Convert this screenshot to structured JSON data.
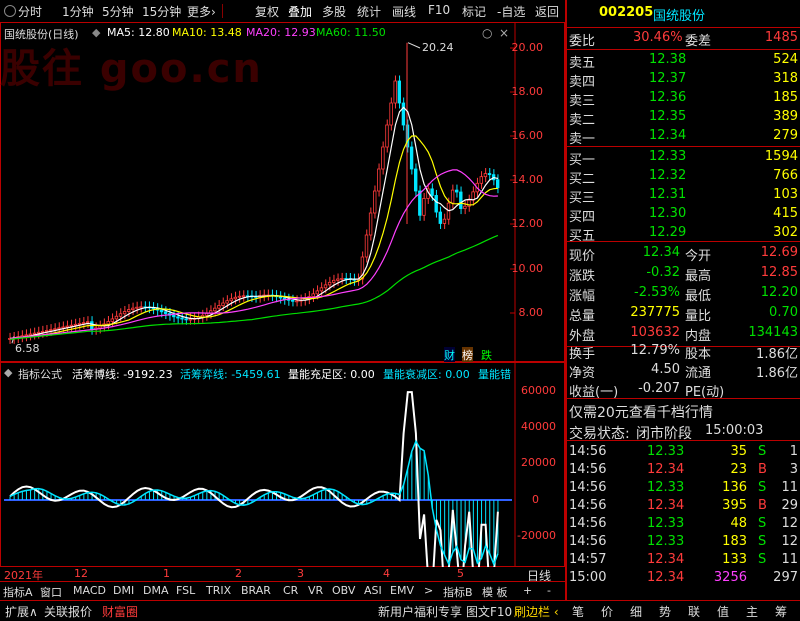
{
  "toolbar": {
    "items": [
      "分时",
      "1分钟",
      "5分钟",
      "15分钟",
      "更多›",
      "复权",
      "叠加",
      "多股",
      "统计",
      "画线",
      "F10",
      "标记",
      "-自选",
      "返回"
    ]
  },
  "chart_legend": {
    "stock": "国统股份(日线)",
    "ma5": "MA5: 12.80",
    "ma10": "MA10: 13.48",
    "ma20": "MA20: 12.93",
    "ma60": "MA60: 11.50",
    "high_label": "20.24",
    "low_label": "6.58",
    "watermark": "股往 goo.cn"
  },
  "price_axis": [
    "20.00",
    "18.00",
    "16.00",
    "14.00",
    "12.00",
    "10.00",
    "8.00"
  ],
  "badges": {
    "cai": "财",
    "bang": "榜",
    "die": "跌"
  },
  "indicator": {
    "title": "指标公式",
    "l1": "活筹博线: -9192.23",
    "l2": "活筹弈线: -5459.61",
    "l3": "量能充足区: 0.00",
    "l4": "量能衰减区: 0.00",
    "l5": "量能错"
  },
  "indicator_axis": [
    "60000",
    "40000",
    "20000",
    "0",
    "-20000"
  ],
  "x_axis": {
    "labels": [
      "2021年",
      "12",
      "1",
      "2",
      "3",
      "4",
      "5"
    ],
    "period": "日线"
  },
  "bottom_tabs": [
    "指标A",
    "窗口",
    "MACD",
    "DMI",
    "DMA",
    "FSL",
    "TRIX",
    "BRAR",
    "CR",
    "VR",
    "OBV",
    "ASI",
    "EMV",
    ">",
    "指标B",
    "模 板",
    "+",
    "-"
  ],
  "status_bar": {
    "items": [
      "扩展∧",
      "关联报价",
      "财富圈"
    ],
    "right_items": [
      "新用户福利专享",
      "图文F10",
      "刷边栏 ‹"
    ],
    "panel_tabs": [
      "笔",
      "价",
      "细",
      "势",
      "联",
      "值",
      "主",
      "筹"
    ]
  },
  "quote": {
    "code": "002205",
    "name": "国统股份",
    "weibi_label": "委比",
    "weibi": "30.46%",
    "weicha_label": "委差",
    "weicha": "1485",
    "asks": [
      {
        "label": "卖五",
        "price": "12.38",
        "vol": "524"
      },
      {
        "label": "卖四",
        "price": "12.37",
        "vol": "318"
      },
      {
        "label": "卖三",
        "price": "12.36",
        "vol": "185"
      },
      {
        "label": "卖二",
        "price": "12.35",
        "vol": "389"
      },
      {
        "label": "卖一",
        "price": "12.34",
        "vol": "279"
      }
    ],
    "bids": [
      {
        "label": "买一",
        "price": "12.33",
        "vol": "1594"
      },
      {
        "label": "买二",
        "price": "12.32",
        "vol": "766"
      },
      {
        "label": "买三",
        "price": "12.31",
        "vol": "103"
      },
      {
        "label": "买四",
        "price": "12.30",
        "vol": "415"
      },
      {
        "label": "买五",
        "price": "12.29",
        "vol": "302"
      }
    ],
    "stats": [
      {
        "l1": "现价",
        "v1": "12.34",
        "c1": "green",
        "l2": "今开",
        "v2": "12.69",
        "c2": "red"
      },
      {
        "l1": "涨跌",
        "v1": "-0.32",
        "c1": "green",
        "l2": "最高",
        "v2": "12.85",
        "c2": "red"
      },
      {
        "l1": "涨幅",
        "v1": "-2.53%",
        "c1": "green",
        "l2": "最低",
        "v2": "12.20",
        "c2": "green"
      },
      {
        "l1": "总量",
        "v1": "237775",
        "c1": "yellow",
        "l2": "量比",
        "v2": "0.70",
        "c2": "green"
      },
      {
        "l1": "外盘",
        "v1": "103632",
        "c1": "red",
        "l2": "内盘",
        "v2": "134143",
        "c2": "green"
      }
    ],
    "stats2": [
      {
        "l1": "换手",
        "v1": "12.79%",
        "l2": "股本",
        "v2": "1.86亿"
      },
      {
        "l1": "净资",
        "v1": "4.50",
        "l2": "流通",
        "v2": "1.86亿"
      },
      {
        "l1": "收益(一)",
        "v1": "-0.207",
        "l2": "PE(动)",
        "v2": ""
      }
    ],
    "promo": "仅需20元查看千档行情",
    "trade_state_label": "交易状态:",
    "trade_state": "闭市阶段",
    "trade_time": "15:00:03",
    "ticks": [
      {
        "t": "14:56",
        "p": "12.33",
        "v": "35",
        "bs": "S",
        "n": "1"
      },
      {
        "t": "14:56",
        "p": "12.34",
        "v": "23",
        "bs": "B",
        "n": "3"
      },
      {
        "t": "14:56",
        "p": "12.33",
        "v": "136",
        "bs": "S",
        "n": "11"
      },
      {
        "t": "14:56",
        "p": "12.34",
        "v": "395",
        "bs": "B",
        "n": "29"
      },
      {
        "t": "14:56",
        "p": "12.33",
        "v": "48",
        "bs": "S",
        "n": "12"
      },
      {
        "t": "14:56",
        "p": "12.33",
        "v": "183",
        "bs": "S",
        "n": "12"
      },
      {
        "t": "14:57",
        "p": "12.34",
        "v": "133",
        "bs": "S",
        "n": "11"
      },
      {
        "t": "15:00",
        "p": "12.34",
        "v": "3256",
        "bs": "",
        "n": "297"
      }
    ]
  },
  "colors": {
    "up": "#ff3b3b",
    "down": "#00e5ff",
    "ma5": "#ffffff",
    "ma10": "#ffff00",
    "ma20": "#ff40ff",
    "ma60": "#00e000"
  }
}
